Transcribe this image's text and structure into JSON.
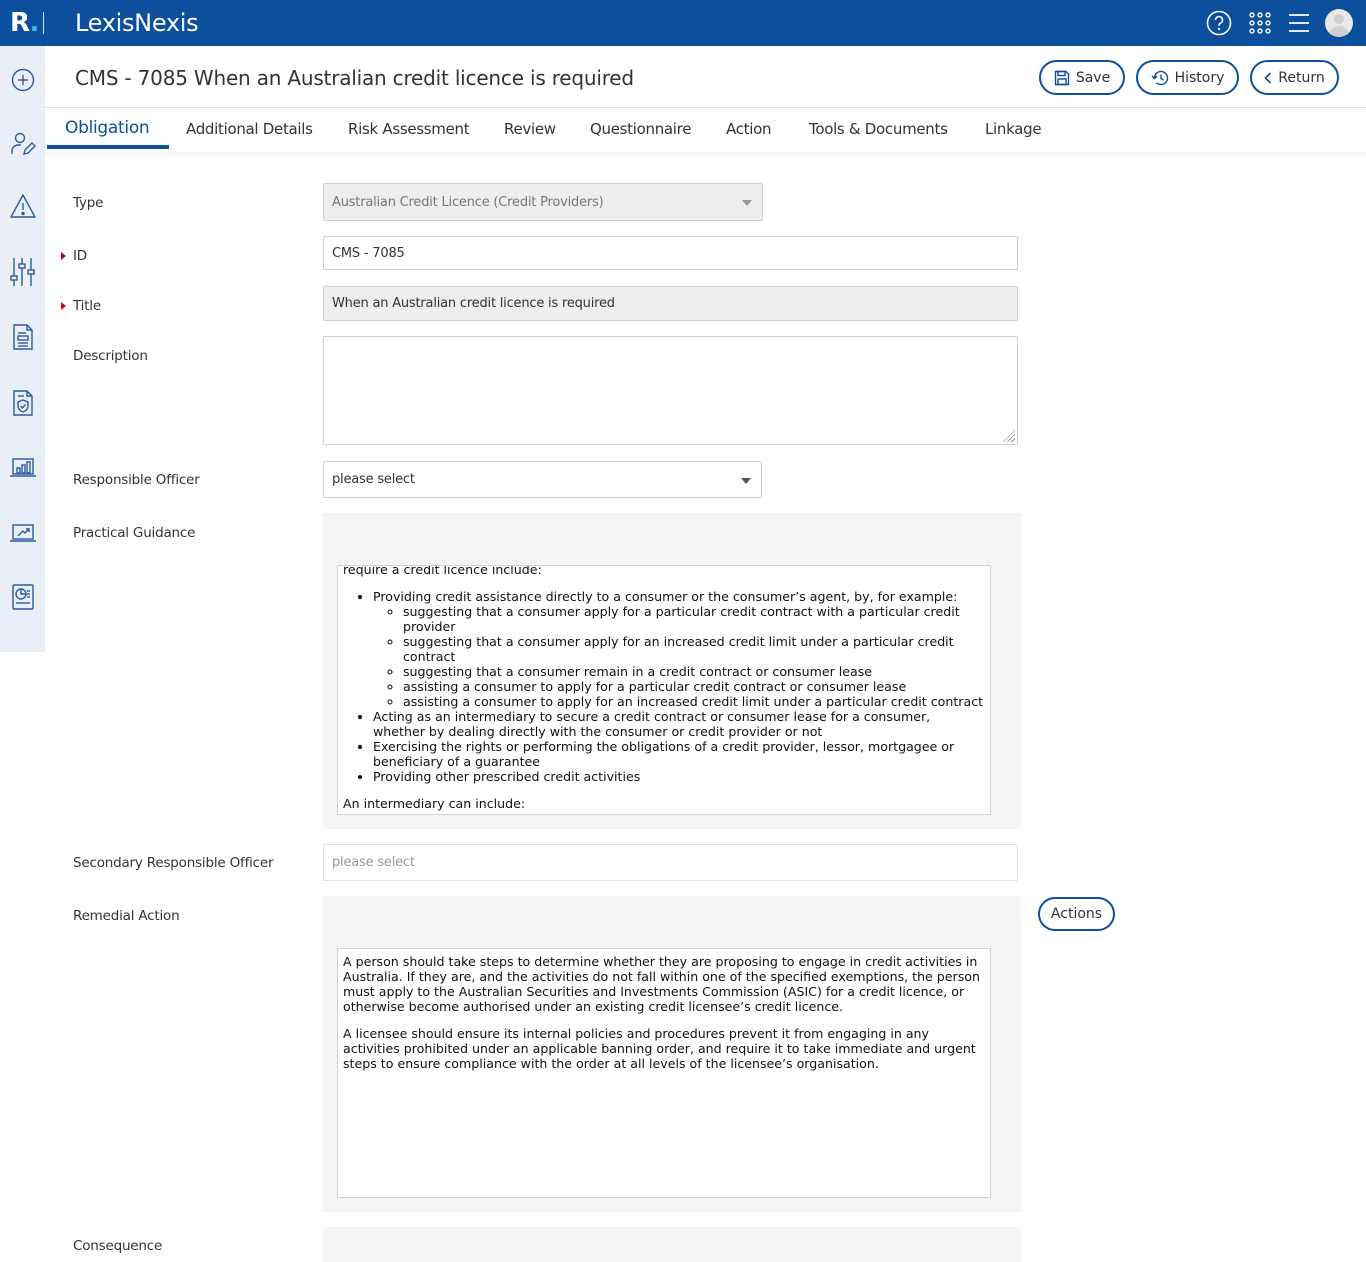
{
  "topbar": {
    "logo_letter": "R",
    "logo_dot": ".",
    "brand": "LexisNexis",
    "icons": [
      "help-icon",
      "apps-grid-icon",
      "menu-icon",
      "user-avatar"
    ]
  },
  "sidenav": {
    "items": [
      {
        "icon": "add-circle-icon",
        "label": "Create"
      },
      {
        "icon": "user-edit-icon",
        "label": "Users"
      },
      {
        "icon": "warning-icon",
        "label": "Incidents"
      },
      {
        "icon": "sliders-icon",
        "label": "Controls"
      },
      {
        "icon": "document-icon",
        "label": "Documents"
      },
      {
        "icon": "shield-document-icon",
        "label": "Compliance"
      },
      {
        "icon": "bar-chart-laptop-icon",
        "label": "Reports"
      },
      {
        "icon": "trend-laptop-icon",
        "label": "Analytics"
      },
      {
        "icon": "pie-report-icon",
        "label": "Dashboards"
      }
    ]
  },
  "header": {
    "title": "CMS - 7085 When an Australian credit licence is required",
    "buttons": {
      "save": "Save",
      "history": "History",
      "return": "Return"
    }
  },
  "tabs": [
    {
      "label": "Obligation",
      "active": true
    },
    {
      "label": "Additional Details",
      "active": false
    },
    {
      "label": "Risk Assessment",
      "active": false
    },
    {
      "label": "Review",
      "active": false
    },
    {
      "label": "Questionnaire",
      "active": false
    },
    {
      "label": "Action",
      "active": false
    },
    {
      "label": "Tools & Documents",
      "active": false
    },
    {
      "label": "Linkage",
      "active": false
    }
  ],
  "form": {
    "type": {
      "label": "Type",
      "value": "Australian Credit Licence (Credit Providers)"
    },
    "id": {
      "label": "ID",
      "value": "CMS - 7085",
      "required": true
    },
    "title": {
      "label": "Title",
      "value": "When an Australian credit licence is required",
      "required": true
    },
    "description": {
      "label": "Description",
      "value": ""
    },
    "responsible_officer": {
      "label": "Responsible Officer",
      "value": "please select"
    },
    "practical_guidance": {
      "label": "Practical Guidance",
      "intro_tail": "require a credit licence include:",
      "bullets": [
        {
          "text": "Providing credit assistance directly to a consumer or the consumer’s agent, by, for example:",
          "sub": [
            "suggesting that a consumer apply for a particular credit contract with a particular credit provider",
            "suggesting that a consumer apply for an increased credit limit under a particular credit contract",
            "suggesting that a consumer remain in a credit contract or consumer lease",
            "assisting a consumer to apply for a particular credit contract or consumer lease",
            "assisting a consumer to apply for an increased credit limit under a particular credit contract"
          ]
        },
        {
          "text": "Acting as an intermediary to secure a credit contract or consumer lease for a consumer, whether by dealing directly with the consumer or credit provider or not",
          "sub": []
        },
        {
          "text": "Exercising the rights or performing the obligations of a credit provider, lessor, mortgagee or beneficiary of a guarantee",
          "sub": []
        },
        {
          "text": "Providing other prescribed credit activities",
          "sub": []
        }
      ],
      "outro": "An intermediary can include:"
    },
    "secondary_responsible_officer": {
      "label": "Secondary Responsible Officer",
      "placeholder": "please select"
    },
    "remedial_action": {
      "label": "Remedial Action",
      "actions_button": "Actions",
      "paragraphs": [
        "A person should take steps to determine whether they are proposing to engage in credit activities in Australia. If they are, and the activities do not fall within one of the specified exemptions, the person must apply to the Australian Securities and Investments Commission (ASIC) for a credit licence, or otherwise become authorised under an existing credit licensee’s credit licence.",
        "A licensee should ensure its internal policies and procedures prevent it from engaging in any activities prohibited under an applicable banning order, and require it to take immediate and urgent steps to ensure compliance with the order at all levels of the licensee’s organisation."
      ]
    },
    "consequence": {
      "label": "Consequence"
    }
  },
  "colors": {
    "brand_blue": "#0c4f9c",
    "required_marker": "#d0021b",
    "sidenav_bg": "#eaeff7"
  }
}
